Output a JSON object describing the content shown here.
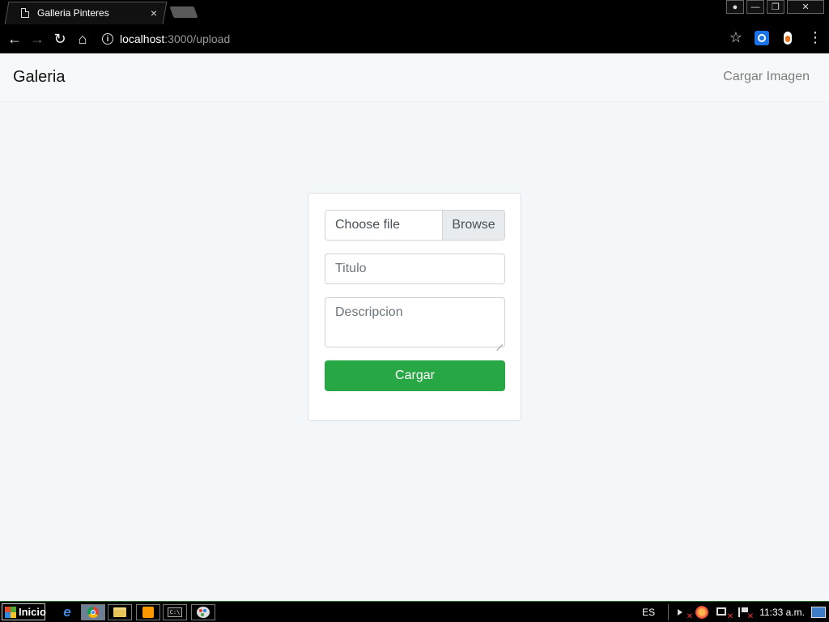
{
  "browser": {
    "tab_title": "Galleria Pinteres",
    "tab_close": "×",
    "window_buttons": {
      "account": "●",
      "minimize": "—",
      "restore": "❐",
      "close": "✕"
    },
    "nav": {
      "back": "←",
      "forward": "→",
      "reload": "↻",
      "home": "⌂"
    },
    "url_host": "localhost",
    "url_path": ":3000/upload",
    "info_icon": "i",
    "bookmark_icon": "☆",
    "menu_icon": "⋮",
    "extensions": [
      "blue-chat-extension-icon",
      "orange-extension-icon"
    ]
  },
  "page": {
    "brand": "Galeria",
    "nav_link": "Cargar Imagen",
    "form": {
      "file_label": "Choose file",
      "file_button": "Browse",
      "title_placeholder": "Titulo",
      "description_placeholder": "Descripcion",
      "submit_label": "Cargar"
    },
    "colors": {
      "submit_bg": "#28a745",
      "page_bg": "#f4f7fa"
    }
  },
  "taskbar": {
    "start_label": "Inicio",
    "apps": [
      "internet-explorer-icon",
      "chrome-icon",
      "folder-icon",
      "sublime-icon",
      "cmd-icon",
      "paint-icon"
    ],
    "cmd_text": "C:\\",
    "language": "ES",
    "clock": "11:33 a.m."
  }
}
